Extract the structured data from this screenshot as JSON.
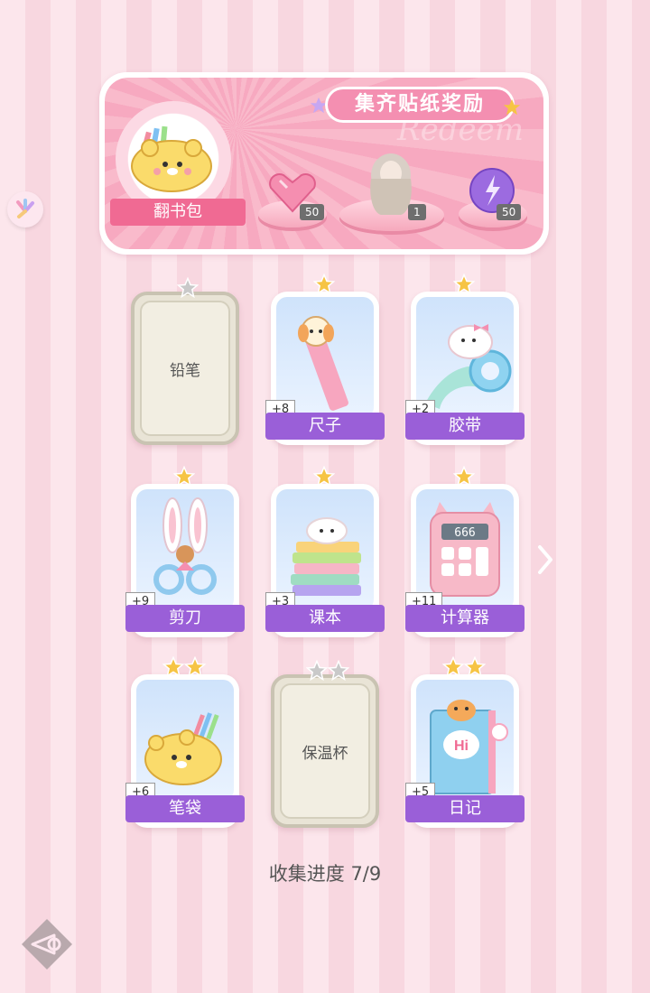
{
  "banner": {
    "title": "集齐贴纸奖励",
    "watermark": "Redeem",
    "book_label": "翻书包",
    "rewards": [
      {
        "icon": "pink-heart-gem-icon",
        "count": "50"
      },
      {
        "icon": "girl-figure-icon",
        "count": "1"
      },
      {
        "icon": "purple-energy-orb-icon",
        "count": "50"
      }
    ]
  },
  "cards": [
    {
      "label": "铅笔",
      "locked": true,
      "stars": 1,
      "plus": ""
    },
    {
      "label": "尺子",
      "locked": false,
      "stars": 1,
      "plus": "+8"
    },
    {
      "label": "胶带",
      "locked": false,
      "stars": 1,
      "plus": "+2"
    },
    {
      "label": "剪刀",
      "locked": false,
      "stars": 1,
      "plus": "+9"
    },
    {
      "label": "课本",
      "locked": false,
      "stars": 1,
      "plus": "+3"
    },
    {
      "label": "计算器",
      "locked": false,
      "stars": 1,
      "plus": "+11"
    },
    {
      "label": "笔袋",
      "locked": false,
      "stars": 2,
      "plus": "+6"
    },
    {
      "label": "保温杯",
      "locked": true,
      "stars": 2,
      "plus": ""
    },
    {
      "label": "日记",
      "locked": false,
      "stars": 2,
      "plus": "+5"
    }
  ],
  "calculator_display": "666",
  "diary_bubble": "Hi",
  "progress": {
    "label": "收集进度",
    "value": "7/9"
  },
  "colors": {
    "accent_purple": "#9a5fd8",
    "banner_pink": "#f48fb1",
    "star_gold": "#f6c444",
    "star_gray": "#c9c9c9"
  }
}
